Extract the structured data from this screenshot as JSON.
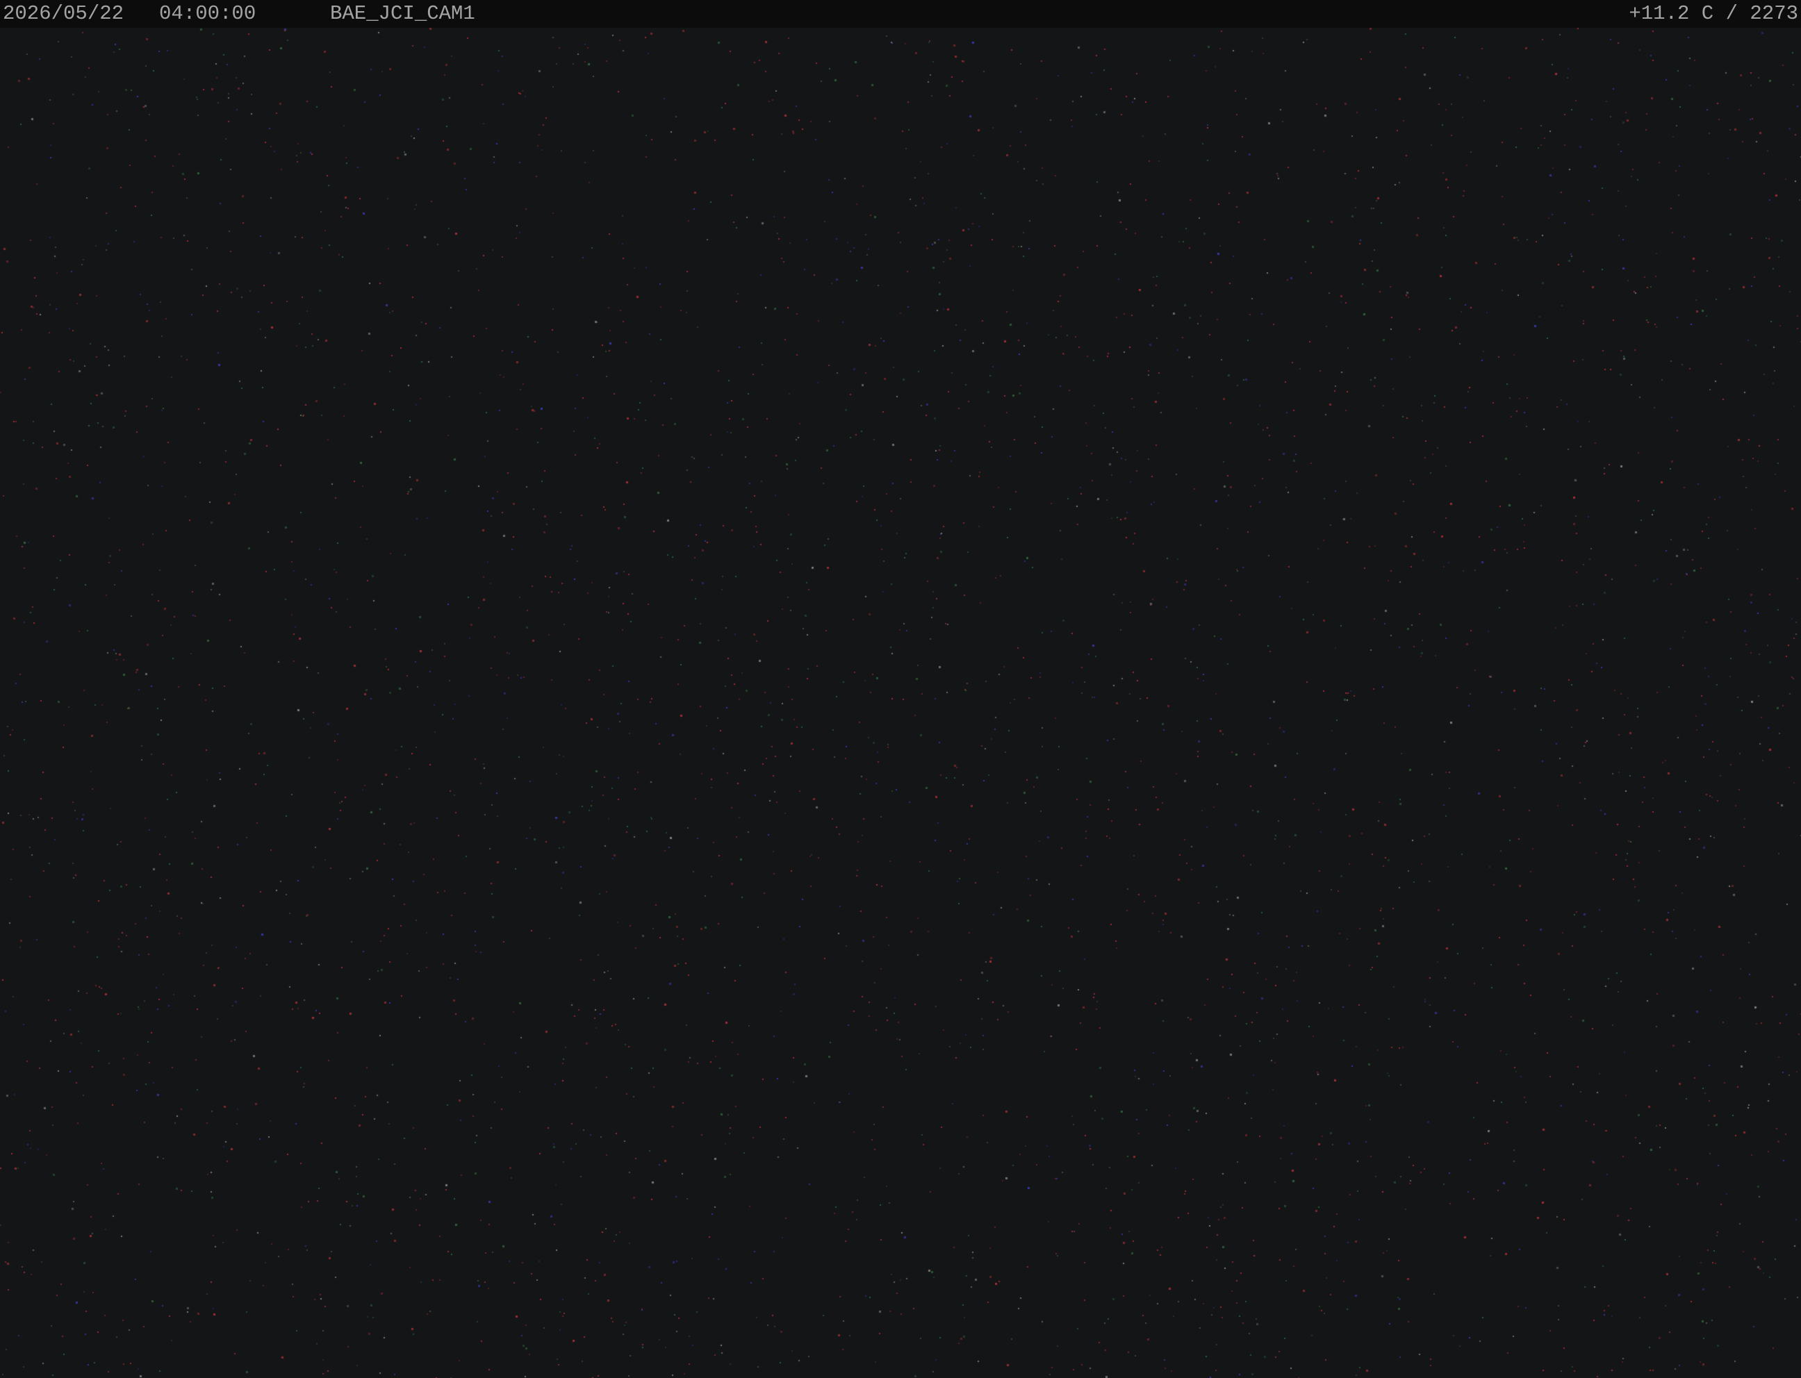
{
  "overlay": {
    "date": "2026/05/22",
    "time": "04:00:00",
    "camera_name": "BAE_JCI_CAM1",
    "temperature_readout": "+11.2 C / 2273"
  },
  "colors": {
    "sky_background": "#141516",
    "overlay_bar": "#0c0c0c",
    "overlay_text": "#a4a4a4",
    "noise_red": "#b0303c",
    "noise_green": "#2f6a40",
    "noise_blue": "#3a3ab8",
    "noise_white": "#8a8a8a"
  }
}
